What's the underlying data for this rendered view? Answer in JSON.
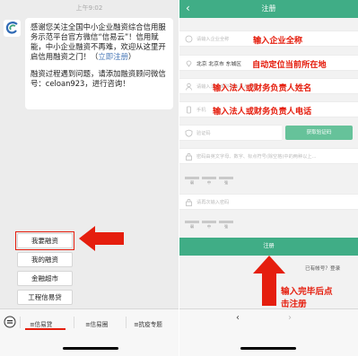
{
  "left": {
    "time": "上午9:02",
    "message": {
      "text_main": "感谢您关注全国中小企业融资综合信用服务示范平台官方微信“信易云”！信用赋能，中小企业融资不再难，欢迎从这里开启信用融资之门！（",
      "link": "立即注册",
      "text_close": "）",
      "text2": "融资过程遇到问题，请添加融资顾问微信号：celoan923，进行咨询！"
    },
    "menu": [
      "我要融资",
      "我的融资",
      "金融超市",
      "工程信易贷"
    ],
    "tabs": [
      "≡信易贷",
      "≡信易圈",
      "≡抗疫专题"
    ],
    "accent": "#e51e0e"
  },
  "right": {
    "header": {
      "back": "‹",
      "title": "注册"
    },
    "fields": {
      "company": {
        "placeholder": "请输入企业全称",
        "annotation": "输入企业全称"
      },
      "location": {
        "value": "北京 北京市 东城区",
        "annotation": "自动定位当前所在地"
      },
      "name": {
        "placeholder": "请输入法人或财务负责人姓名",
        "annotation": "输入法人或财务负责人姓名"
      },
      "phone": {
        "placeholder": "手机",
        "annotation": "输入法人或财务负责人电话"
      },
      "code": {
        "placeholder": "验证码",
        "button": "获取验证码"
      },
      "password": {
        "placeholder": "密码由英文字母、数字、标点符号(除空格)中的两种以上..."
      },
      "confirm": {
        "placeholder": "请再次输入密码"
      }
    },
    "strength_labels": [
      "弱",
      "中",
      "强"
    ],
    "register_button": "注册",
    "login_link": "已有帐号？登录",
    "submit_annotation_line1": "输入完毕后点",
    "submit_annotation_line2": "击注册",
    "nav": {
      "back": "‹",
      "forward": "›"
    },
    "brand_color": "#40ad86"
  }
}
